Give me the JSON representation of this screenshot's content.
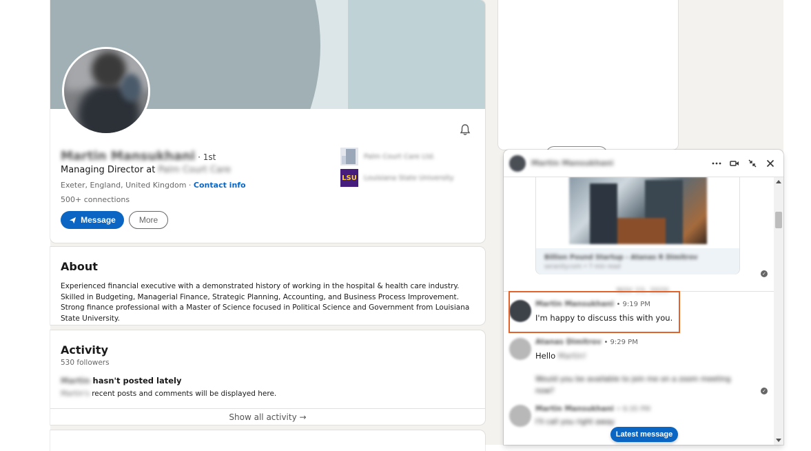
{
  "profile": {
    "name": "Martin Mansukhani",
    "degree": "· 1st",
    "headline_prefix": "Managing Director at",
    "headline_company": "Palm Court Care",
    "location": "Exeter, England, United Kingdom ·",
    "contact_info": "Contact info",
    "connections": "500+ connections",
    "message_label": "Message",
    "more_label": "More",
    "companies": [
      {
        "name": "Palm Court Care Ltd."
      },
      {
        "name": "Louisiana State University",
        "logo_text": "LSU"
      }
    ]
  },
  "about": {
    "title": "About",
    "text": "Experienced financial executive with a demonstrated history of working in the hospital & health care industry. Skilled in Budgeting, Managerial Finance, Strategic Planning, Accounting, and Business Process Improvement. Strong finance professional with a Master of Science focused in Political Science and Government from Louisiana State University."
  },
  "activity": {
    "title": "Activity",
    "followers": "530 followers",
    "posted_name": "Martin",
    "posted_text": "hasn't posted lately",
    "sub_name": "Martin's",
    "sub_text": "recent posts and comments will be displayed here.",
    "show_all": "Show all activity →"
  },
  "messaging": {
    "header_name": "Martin Mansukhani",
    "link_card": {
      "title": "Billion Pound Startup - Atanas R Dimitrov",
      "source": "seranity.com • 7 min read"
    },
    "date_divider": "NOV 23, 2020",
    "messages": [
      {
        "sender": "Martin Mansukhani",
        "time": "• 9:19 PM",
        "text": "I'm happy to discuss this with you."
      },
      {
        "sender": "Atanas Dimitrov",
        "time": "• 9:29 PM",
        "text_prefix": "Hello",
        "text_blur": "Martin!"
      },
      {
        "text_line1_blur": "Would you be available to join me on a zoom meeting",
        "text_line2_blur": "now?"
      },
      {
        "sender": "Martin Mansukhani",
        "time": "• 9:35 PM",
        "text_blur": "I'll call you right away"
      }
    ],
    "latest_message": "Latest message"
  },
  "colors": {
    "accent": "#0a66c2",
    "highlight": "#e2622a",
    "page_bg": "#f3f2ef"
  }
}
